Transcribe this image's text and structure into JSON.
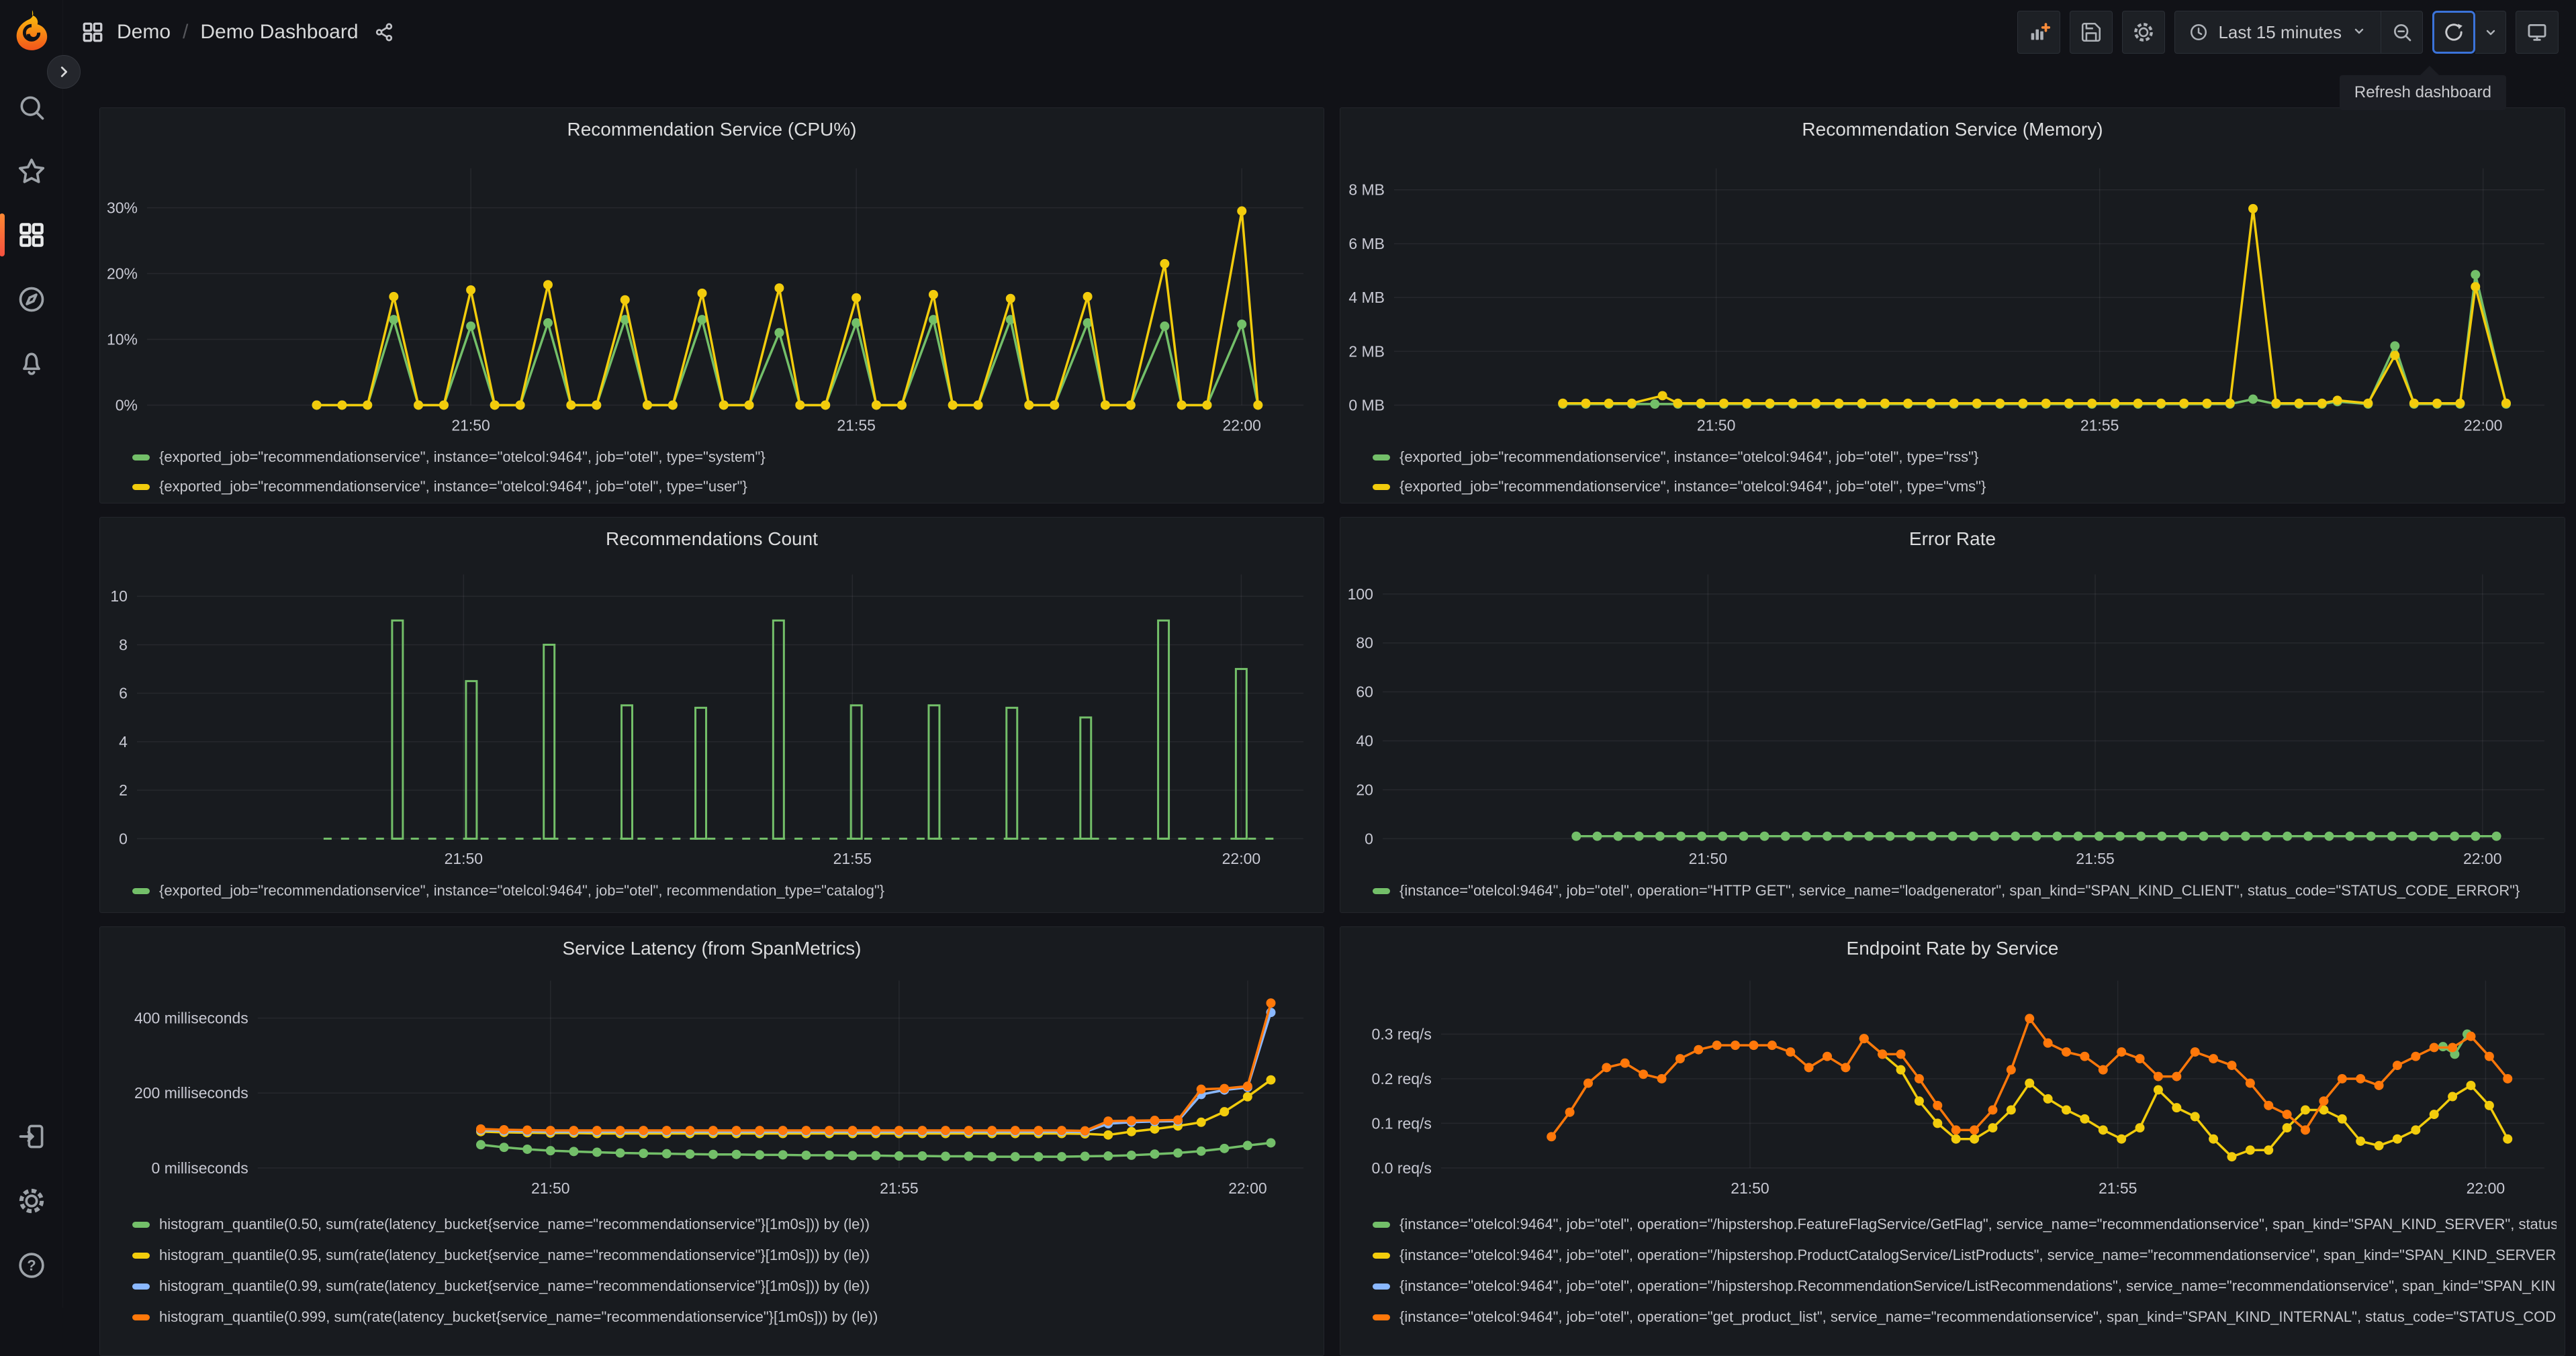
{
  "header": {
    "breadcrumb": {
      "section": "Demo",
      "separator": "/",
      "page": "Demo Dashboard"
    },
    "toolbar": {
      "time_range": "Last 15 minutes",
      "refresh_tooltip": "Refresh dashboard"
    }
  },
  "colors": {
    "green": "#73BF69",
    "yellow": "#F2CC0C",
    "blue": "#8AB8FF",
    "orange": "#FF780A",
    "accent_blue": "#3B73D9",
    "grid": "rgba(204,204,220,0.08)",
    "axis_text": "#C8C9D3"
  },
  "x_axis": {
    "tick_labels": [
      "21:50",
      "21:55",
      "22:00"
    ]
  },
  "panels": [
    {
      "title": "Recommendation Service (CPU%)",
      "legend": [
        {
          "color": "#73BF69",
          "label": "{exported_job=\"recommendationservice\", instance=\"otelcol:9464\", job=\"otel\", type=\"system\"}"
        },
        {
          "color": "#F2CC0C",
          "label": "{exported_job=\"recommendationservice\", instance=\"otelcol:9464\", job=\"otel\", type=\"user\"}"
        }
      ],
      "chart": {
        "type": "line",
        "vb": [
          1824,
          590
        ],
        "x_domain": [
          45.8,
          60.8
        ],
        "x_ticks": [
          {
            "v": 50,
            "l": "21:50"
          },
          {
            "v": 55,
            "l": "21:55"
          },
          {
            "v": 60,
            "l": "22:00"
          }
        ],
        "y_max": 36,
        "y_ticks": [
          {
            "v": 0,
            "l": "0%"
          },
          {
            "v": 10,
            "l": "10%"
          },
          {
            "v": 20,
            "l": "20%"
          },
          {
            "v": 30,
            "l": "30%"
          }
        ],
        "plot": {
          "left": 70,
          "right": 1794,
          "top": 90,
          "bottom": 444
        },
        "series": [
          {
            "color": "#73BF69",
            "baseline": {
              "from": 48.0,
              "to": 60.35,
              "step": 0.33,
              "y": 0
            },
            "spikes": [
              [
                49,
                13
              ],
              [
                50,
                12
              ],
              [
                51,
                12.5
              ],
              [
                52,
                13
              ],
              [
                53,
                13
              ],
              [
                54,
                11
              ],
              [
                55,
                12.5
              ],
              [
                56,
                13
              ],
              [
                57,
                13
              ],
              [
                58,
                12.5
              ],
              [
                59,
                12
              ],
              [
                60,
                12.3
              ]
            ]
          },
          {
            "color": "#F2CC0C",
            "baseline": {
              "from": 48.0,
              "to": 60.35,
              "step": 0.33,
              "y": 0
            },
            "spikes": [
              [
                49,
                16.5
              ],
              [
                50,
                17.5
              ],
              [
                51,
                18.3
              ],
              [
                52,
                16
              ],
              [
                53,
                17
              ],
              [
                54,
                17.8
              ],
              [
                55,
                16.3
              ],
              [
                56,
                16.8
              ],
              [
                57,
                16.2
              ],
              [
                58,
                16.5
              ],
              [
                59,
                21.5
              ],
              [
                60,
                29.5
              ]
            ]
          }
        ]
      }
    },
    {
      "title": "Recommendation Service (Memory)",
      "legend": [
        {
          "color": "#73BF69",
          "label": "{exported_job=\"recommendationservice\", instance=\"otelcol:9464\", job=\"otel\", type=\"rss\"}"
        },
        {
          "color": "#F2CC0C",
          "label": "{exported_job=\"recommendationservice\", instance=\"otelcol:9464\", job=\"otel\", type=\"vms\"}"
        }
      ],
      "chart": {
        "type": "line",
        "vb": [
          1824,
          590
        ],
        "x_domain": [
          45.8,
          60.8
        ],
        "x_ticks": [
          {
            "v": 50,
            "l": "21:50"
          },
          {
            "v": 55,
            "l": "21:55"
          },
          {
            "v": 60,
            "l": "22:00"
          }
        ],
        "y_max": 8.8,
        "y_ticks": [
          {
            "v": 0,
            "l": "0 MB"
          },
          {
            "v": 2,
            "l": "2 MB"
          },
          {
            "v": 4,
            "l": "4 MB"
          },
          {
            "v": 6,
            "l": "6 MB"
          },
          {
            "v": 8,
            "l": "8 MB"
          }
        ],
        "plot": {
          "left": 80,
          "right": 1794,
          "top": 90,
          "bottom": 444
        },
        "series": [
          {
            "color": "#73BF69",
            "baseline": {
              "from": 48.0,
              "to": 60.35,
              "step": 0.3,
              "y": 0.04
            },
            "spikes": [
              [
                57,
                0.22
              ],
              [
                58.1,
                0.13
              ],
              [
                58.85,
                2.2
              ],
              [
                59.9,
                4.85
              ]
            ]
          },
          {
            "color": "#F2CC0C",
            "baseline": {
              "from": 48.0,
              "to": 60.35,
              "step": 0.3,
              "y": 0.07
            },
            "spikes": [
              [
                49.3,
                0.35
              ],
              [
                57,
                7.3
              ],
              [
                58.1,
                0.18
              ],
              [
                58.85,
                1.85
              ],
              [
                59.9,
                4.4
              ]
            ]
          }
        ]
      }
    },
    {
      "title": "Recommendations Count",
      "legend": [
        {
          "color": "#73BF69",
          "label": "{exported_job=\"recommendationservice\", instance=\"otelcol:9464\", job=\"otel\", recommendation_type=\"catalog\"}"
        }
      ],
      "chart": {
        "type": "bar",
        "vb": [
          1824,
          590
        ],
        "x_domain": [
          45.8,
          60.8
        ],
        "x_ticks": [
          {
            "v": 50,
            "l": "21:50"
          },
          {
            "v": 55,
            "l": "21:55"
          },
          {
            "v": 60,
            "l": "22:00"
          }
        ],
        "y_max": 10.9,
        "y_ticks": [
          {
            "v": 0,
            "l": "0"
          },
          {
            "v": 2,
            "l": "2"
          },
          {
            "v": 4,
            "l": "4"
          },
          {
            "v": 6,
            "l": "6"
          },
          {
            "v": 8,
            "l": "8"
          },
          {
            "v": 10,
            "l": "10"
          }
        ],
        "plot": {
          "left": 55,
          "right": 1794,
          "top": 85,
          "bottom": 480
        },
        "baseline_dash": {
          "from": 48.2,
          "to": 60.45,
          "y": 0,
          "color": "#73BF69"
        },
        "bars": {
          "color": "#73BF69",
          "width": 16,
          "values": [
            [
              49.15,
              9
            ],
            [
              50.1,
              6.5
            ],
            [
              51.1,
              8
            ],
            [
              52.1,
              5.5
            ],
            [
              53.05,
              5.4
            ],
            [
              54.05,
              9
            ],
            [
              55.05,
              5.5
            ],
            [
              56.05,
              5.5
            ],
            [
              57.05,
              5.4
            ],
            [
              58,
              5
            ],
            [
              59,
              9
            ],
            [
              60,
              7
            ]
          ]
        }
      }
    },
    {
      "title": "Error Rate",
      "legend": [
        {
          "color": "#73BF69",
          "label": "{instance=\"otelcol:9464\", job=\"otel\", operation=\"HTTP GET\", service_name=\"loadgenerator\", span_kind=\"SPAN_KIND_CLIENT\", status_code=\"STATUS_CODE_ERROR\"}"
        }
      ],
      "chart": {
        "type": "line",
        "vb": [
          1824,
          590
        ],
        "x_domain": [
          45.8,
          60.8
        ],
        "x_ticks": [
          {
            "v": 50,
            "l": "21:50"
          },
          {
            "v": 55,
            "l": "21:55"
          },
          {
            "v": 60,
            "l": "22:00"
          }
        ],
        "y_max": 108,
        "y_ticks": [
          {
            "v": 0,
            "l": "0"
          },
          {
            "v": 20,
            "l": "20"
          },
          {
            "v": 40,
            "l": "40"
          },
          {
            "v": 60,
            "l": "60"
          },
          {
            "v": 80,
            "l": "80"
          },
          {
            "v": 100,
            "l": "100"
          }
        ],
        "plot": {
          "left": 63,
          "right": 1794,
          "top": 85,
          "bottom": 480
        },
        "series": [
          {
            "color": "#73BF69",
            "baseline": {
              "from": 48.3,
              "to": 60.35,
              "step": 0.27,
              "y": 1
            },
            "spikes": []
          }
        ]
      }
    },
    {
      "title": "Service Latency (from SpanMetrics)",
      "legend": [
        {
          "color": "#73BF69",
          "label": "histogram_quantile(0.50, sum(rate(latency_bucket{service_name=\"recommendationservice\"}[1m0s])) by (le))"
        },
        {
          "color": "#F2CC0C",
          "label": "histogram_quantile(0.95, sum(rate(latency_bucket{service_name=\"recommendationservice\"}[1m0s])) by (le))"
        },
        {
          "color": "#8AB8FF",
          "label": "histogram_quantile(0.99, sum(rate(latency_bucket{service_name=\"recommendationservice\"}[1m0s])) by (le))"
        },
        {
          "color": "#FF780A",
          "label": "histogram_quantile(0.999, sum(rate(latency_bucket{service_name=\"recommendationservice\"}[1m0s])) by (le))"
        }
      ],
      "chart": {
        "type": "line",
        "vb": [
          1824,
          640
        ],
        "x_domain": [
          45.8,
          60.8
        ],
        "x_ticks": [
          {
            "v": 50,
            "l": "21:50"
          },
          {
            "v": 55,
            "l": "21:55"
          },
          {
            "v": 60,
            "l": "22:00"
          }
        ],
        "y_max": 500,
        "y_ticks": [
          {
            "v": 0,
            "l": "0 milliseconds"
          },
          {
            "v": 200,
            "l": "200 milliseconds"
          },
          {
            "v": 400,
            "l": "400 milliseconds"
          }
        ],
        "plot": {
          "left": 235,
          "right": 1794,
          "top": 80,
          "bottom": 360
        },
        "series": [
          {
            "color": "#73BF69",
            "x0": 49,
            "dx": 0.3333,
            "values": [
              62,
              55,
              50,
              46,
              44,
              42,
              40,
              39,
              38,
              37,
              36,
              36,
              35,
              35,
              34,
              34,
              33,
              33,
              32,
              32,
              31,
              31,
              30,
              30,
              30,
              30,
              31,
              32,
              34,
              37,
              40,
              45,
              52,
              60,
              67
            ]
          },
          {
            "color": "#F2CC0C",
            "x0": 49,
            "dx": 0.3333,
            "values": [
              97,
              95,
              94,
              93,
              93,
              92,
              92,
              92,
              92,
              92,
              92,
              92,
              92,
              92,
              92,
              92,
              92,
              92,
              92,
              92,
              92,
              92,
              92,
              92,
              92,
              92,
              91,
              88,
              97,
              104,
              112,
              122,
              150,
              190,
              235
            ]
          },
          {
            "color": "#8AB8FF",
            "x0": 49,
            "dx": 0.3333,
            "values": [
              101,
              99,
              98,
              97,
              97,
              97,
              97,
              97,
              97,
              97,
              97,
              97,
              97,
              97,
              97,
              97,
              97,
              97,
              97,
              97,
              97,
              97,
              97,
              97,
              97,
              97,
              96,
              118,
              122,
              124,
              125,
              196,
              208,
              215,
              415
            ]
          },
          {
            "color": "#FF780A",
            "x0": 49,
            "dx": 0.3333,
            "values": [
              104,
              102,
              101,
              100,
              100,
              100,
              100,
              100,
              100,
              100,
              100,
              100,
              100,
              100,
              100,
              100,
              100,
              100,
              100,
              100,
              100,
              100,
              100,
              100,
              100,
              100,
              99,
              125,
              126,
              127,
              128,
              210,
              212,
              218,
              440
            ]
          }
        ]
      }
    },
    {
      "title": "Endpoint Rate by Service",
      "legend": [
        {
          "color": "#73BF69",
          "label": "{instance=\"otelcol:9464\", job=\"otel\", operation=\"/hipstershop.FeatureFlagService/GetFlag\", service_name=\"recommendationservice\", span_kind=\"SPAN_KIND_SERVER\", status_code=\"STATUS_CODE_OK\"}"
        },
        {
          "color": "#F2CC0C",
          "label": "{instance=\"otelcol:9464\", job=\"otel\", operation=\"/hipstershop.ProductCatalogService/ListProducts\", service_name=\"recommendationservice\", span_kind=\"SPAN_KIND_SERVER\"}"
        },
        {
          "color": "#8AB8FF",
          "label": "{instance=\"otelcol:9464\", job=\"otel\", operation=\"/hipstershop.RecommendationService/ListRecommendations\", service_name=\"recommendationservice\", span_kind=\"SPAN_KIND_SERVER\"}"
        },
        {
          "color": "#FF780A",
          "label": "{instance=\"otelcol:9464\", job=\"otel\", operation=\"get_product_list\", service_name=\"recommendationservice\", span_kind=\"SPAN_KIND_INTERNAL\", status_code=\"STATUS_CODE_OK\"}"
        }
      ],
      "chart": {
        "type": "line",
        "vb": [
          1824,
          640
        ],
        "x_domain": [
          45.8,
          60.8
        ],
        "x_ticks": [
          {
            "v": 50,
            "l": "21:50"
          },
          {
            "v": 55,
            "l": "21:55"
          },
          {
            "v": 60,
            "l": "22:00"
          }
        ],
        "y_max": 0.42,
        "y_ticks": [
          {
            "v": 0,
            "l": "0.0 req/s"
          },
          {
            "v": 0.1,
            "l": "0.1 req/s"
          },
          {
            "v": 0.2,
            "l": "0.2 req/s"
          },
          {
            "v": 0.3,
            "l": "0.3 req/s"
          }
        ],
        "plot": {
          "left": 150,
          "right": 1794,
          "top": 80,
          "bottom": 360
        },
        "series": [
          {
            "color": "#73BF69",
            "points": [
              [
                59.42,
                0.272
              ],
              [
                59.58,
                0.255
              ],
              [
                59.75,
                0.3
              ]
            ]
          },
          {
            "color": "#8AB8FF",
            "points": []
          },
          {
            "color": "#F2CC0C",
            "x0": 51.55,
            "dx": 0.25,
            "values": [
              0.29,
              0.255,
              0.22,
              0.15,
              0.1,
              0.065,
              0.065,
              0.09,
              0.13,
              0.19,
              0.155,
              0.13,
              0.11,
              0.085,
              0.065,
              0.09,
              0.175,
              0.135,
              0.115,
              0.065,
              0.025,
              0.04,
              0.04,
              0.09,
              0.13,
              0.13,
              0.11,
              0.06,
              0.05,
              0.065,
              0.085,
              0.12,
              0.16,
              0.185,
              0.14,
              0.065
            ]
          },
          {
            "color": "#FF780A",
            "x0": 47.3,
            "dx": 0.25,
            "values": [
              0.07,
              0.125,
              0.19,
              0.225,
              0.235,
              0.21,
              0.2,
              0.245,
              0.265,
              0.275,
              0.275,
              0.275,
              0.275,
              0.26,
              0.225,
              0.25,
              0.225,
              0.29,
              0.255,
              0.255,
              0.2,
              0.14,
              0.085,
              0.085,
              0.13,
              0.22,
              0.335,
              0.28,
              0.26,
              0.25,
              0.22,
              0.26,
              0.245,
              0.205,
              0.205,
              0.26,
              0.245,
              0.23,
              0.19,
              0.14,
              0.12,
              0.085,
              0.15,
              0.2,
              0.2,
              0.185,
              0.23,
              0.25,
              0.27,
              0.27,
              0.295,
              0.25,
              0.2
            ]
          }
        ]
      }
    }
  ]
}
